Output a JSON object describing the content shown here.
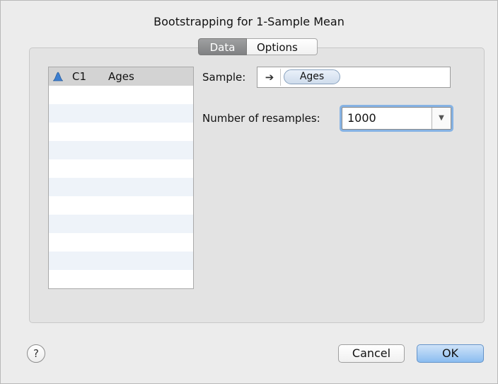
{
  "dialog": {
    "title": "Bootstrapping for 1-Sample Mean"
  },
  "tabs": [
    {
      "label": "Data",
      "selected": true
    },
    {
      "label": "Options",
      "selected": false
    }
  ],
  "variables": [
    {
      "column": "C1",
      "name": "Ages",
      "icon": "distribution-icon",
      "selected": true
    }
  ],
  "form": {
    "sample_label": "Sample:",
    "sample_arrow": "➔",
    "sample_value": "Ages",
    "resamples_label": "Number of resamples:",
    "resamples_value": "1000",
    "resamples_dropdown_glyph": "▼"
  },
  "buttons": {
    "help": "?",
    "cancel": "Cancel",
    "ok": "OK"
  },
  "colors": {
    "accent": "#86b3e4",
    "icon_blue": "#3d7fd0",
    "selected_tab": "#8d8e90"
  }
}
